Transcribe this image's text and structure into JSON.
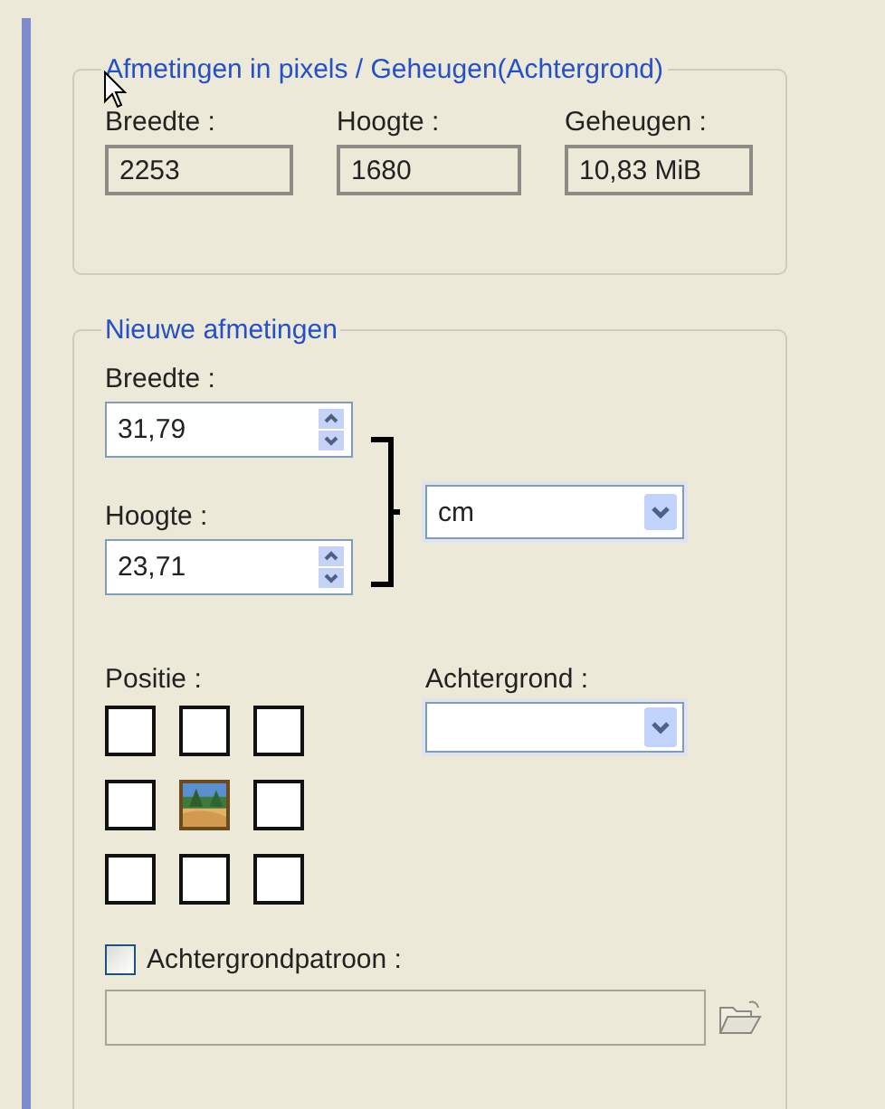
{
  "pixel_group": {
    "title": "Afmetingen in pixels / Geheugen(Achtergrond)",
    "fields": [
      {
        "label": "Breedte :",
        "value": "2253"
      },
      {
        "label": "Hoogte :",
        "value": "1680"
      },
      {
        "label": "Geheugen :",
        "value": "10,83 MiB"
      }
    ]
  },
  "new_group": {
    "title": "Nieuwe afmetingen",
    "width": {
      "label": "Breedte :",
      "value": "31,79"
    },
    "height": {
      "label": "Hoogte :",
      "value": "23,71"
    },
    "unit": {
      "value": "cm"
    },
    "position": {
      "label": "Positie :",
      "cells": [
        {
          "selected": false
        },
        {
          "selected": false
        },
        {
          "selected": false
        },
        {
          "selected": false
        },
        {
          "selected": true
        },
        {
          "selected": false
        },
        {
          "selected": false
        },
        {
          "selected": false
        },
        {
          "selected": false
        }
      ]
    },
    "background": {
      "label": "Achtergrond :"
    },
    "pattern": {
      "label": "Achtergrondpatroon :",
      "checked": false,
      "disabled": true
    }
  }
}
